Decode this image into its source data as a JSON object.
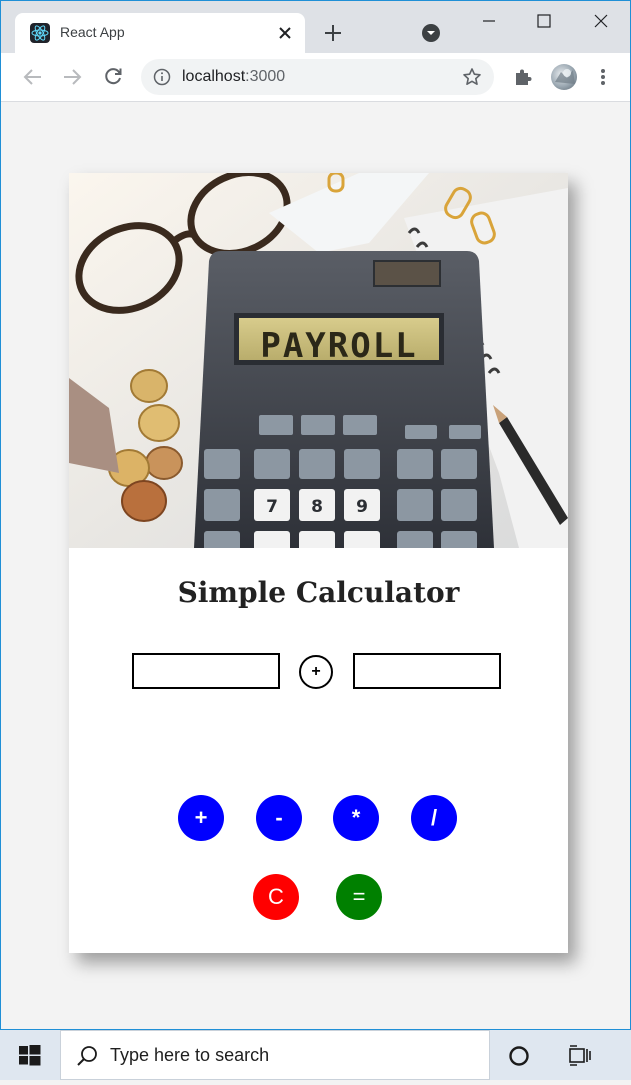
{
  "browser": {
    "tab_title": "React App",
    "tab_favicon": "react-logo-icon",
    "url_host": "localhost",
    "url_port": ":3000"
  },
  "page": {
    "title": "Simple Calculator",
    "image": {
      "calculator_display_text": "PAYROLL",
      "description_icon": "calculator-photo"
    },
    "first_number": {
      "value": "",
      "placeholder": ""
    },
    "second_number": {
      "value": "",
      "placeholder": ""
    },
    "current_operator": "+",
    "operator_buttons": [
      "+",
      "-",
      "*",
      "/"
    ],
    "clear_label": "C",
    "equals_label": "=",
    "colors": {
      "operator_button": "#0000ff",
      "clear_button": "#ff0000",
      "equals_button": "#008000"
    }
  },
  "taskbar": {
    "search_placeholder": "Type here to search"
  }
}
